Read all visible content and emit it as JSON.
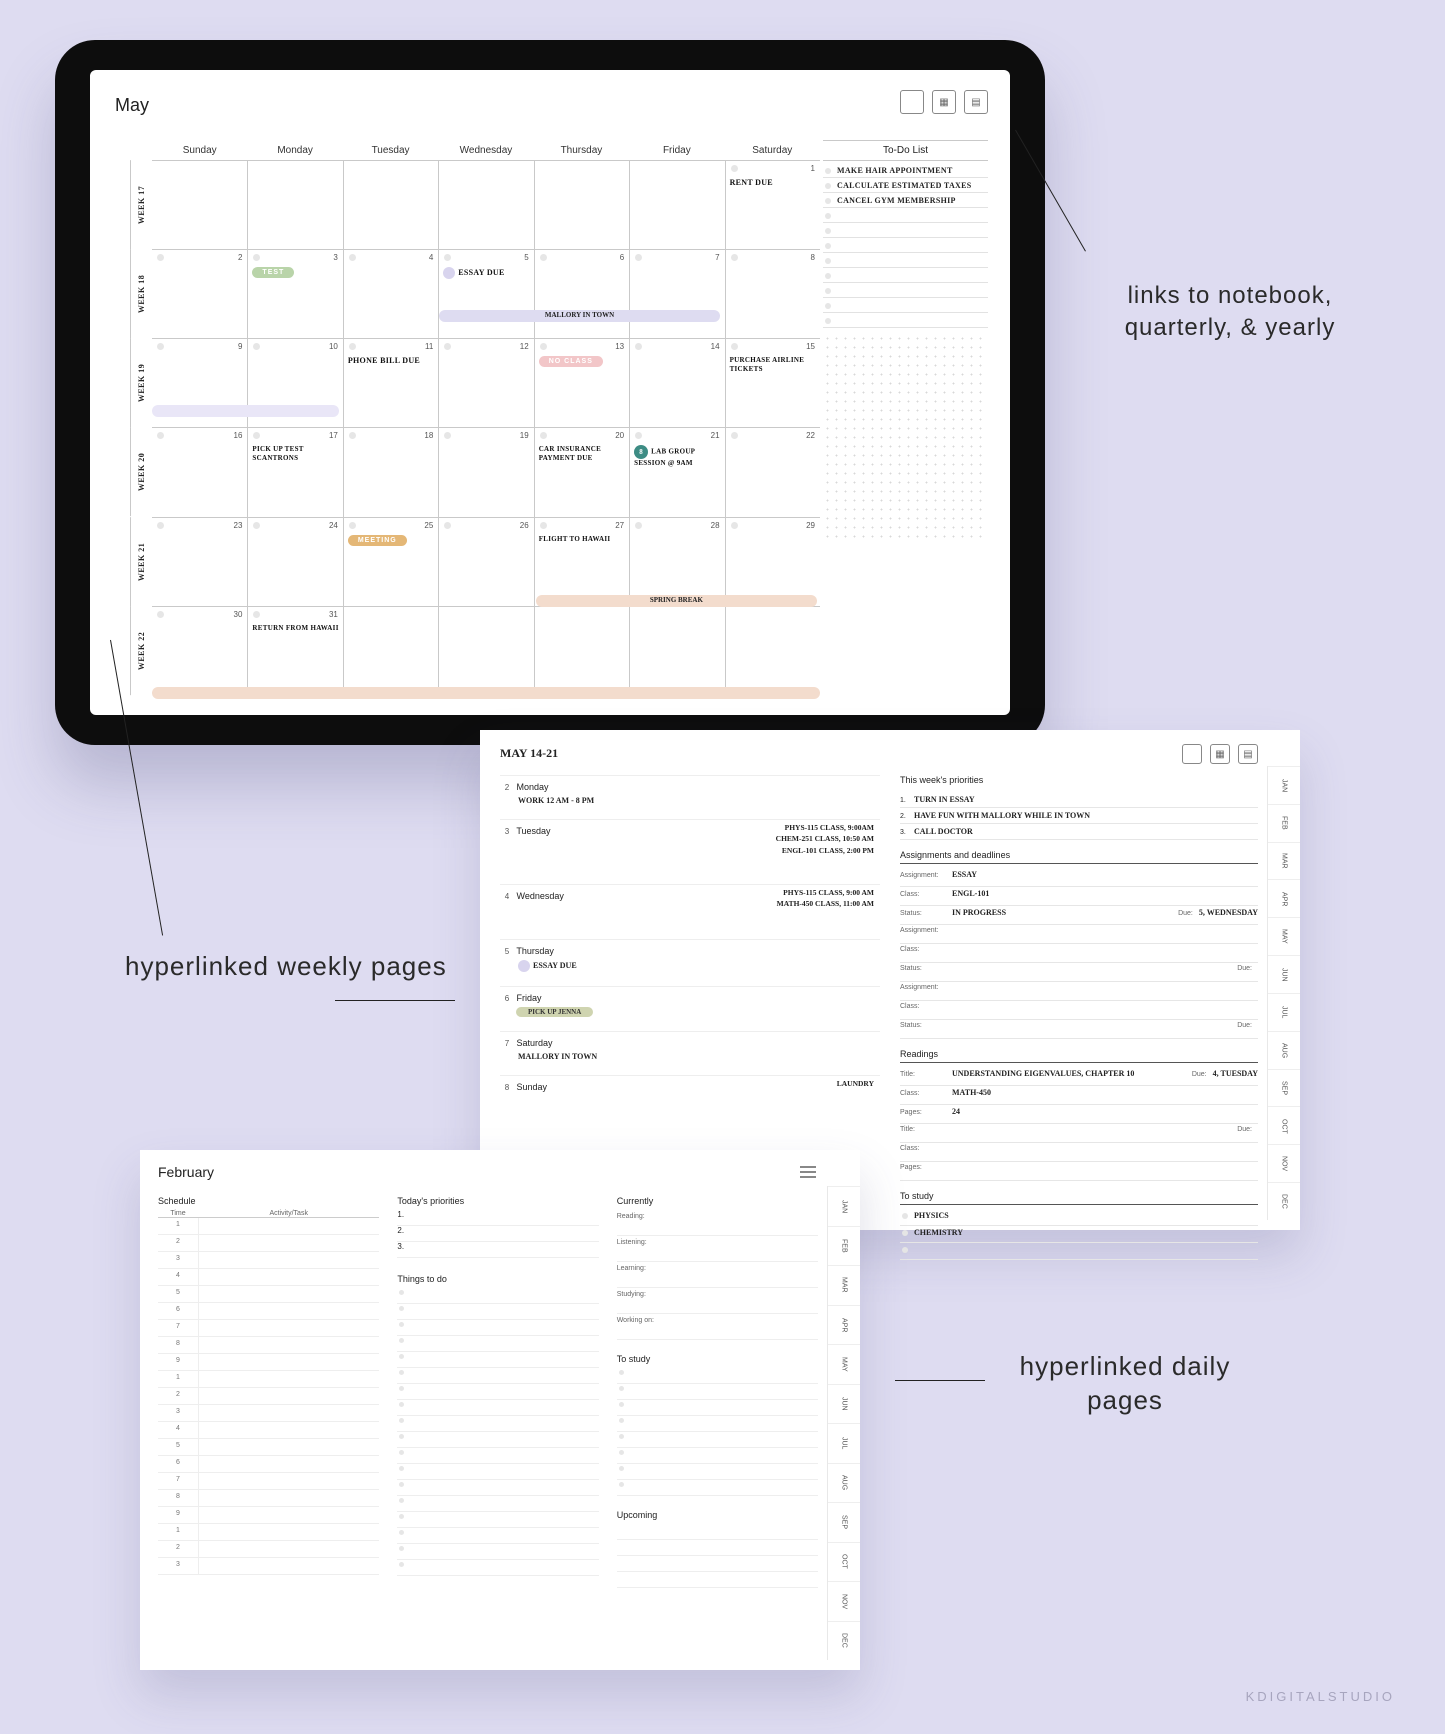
{
  "annotations": {
    "top_right": "links to notebook, quarterly, & yearly",
    "left": "hyperlinked weekly pages",
    "right": "hyperlinked daily pages"
  },
  "watermark": "KDIGITALSTUDIO",
  "monthly": {
    "title": "May",
    "days_of_week": [
      "Sunday",
      "Monday",
      "Tuesday",
      "Wednesday",
      "Thursday",
      "Friday",
      "Saturday"
    ],
    "week_labels": [
      "WEEK 17",
      "WEEK 18",
      "WEEK 19",
      "WEEK 20",
      "WEEK 21",
      "WEEK 22"
    ],
    "todo_title": "To-Do List",
    "todo": [
      "MAKE HAIR APPOINTMENT",
      "CALCULATE ESTIMATED TAXES",
      "CANCEL GYM MEMBERSHIP"
    ],
    "cells": {
      "sat1": "RENT DUE",
      "mon_test": "TEST",
      "wed_essay": "ESSAY DUE",
      "mallory": "MALLORY IN TOWN",
      "tue_phone": "PHONE BILL DUE",
      "thu_noclass": "NO CLASS",
      "sat_airline": "PURCHASE AIRLINE TICKETS",
      "mon_scantrons": "PICK UP TEST SCANTRONS",
      "thu_insurance": "CAR INSURANCE PAYMENT DUE",
      "fri_lab": "LAB GROUP SESSION @ 9AM",
      "tue_meeting": "MEETING",
      "thu_flight": "FLIGHT TO HAWAII",
      "spring_break": "SPRING BREAK",
      "mon_return": "RETURN FROM HAWAII"
    },
    "numbers": [
      "",
      "",
      "",
      "",
      "",
      "",
      "1",
      "2",
      "3",
      "4",
      "5",
      "6",
      "7",
      "8",
      "9",
      "10",
      "11",
      "12",
      "13",
      "14",
      "15",
      "16",
      "17",
      "18",
      "19",
      "20",
      "21",
      "22",
      "23",
      "24",
      "25",
      "26",
      "27",
      "28",
      "29",
      "30",
      "31",
      "",
      "",
      "",
      "",
      ""
    ]
  },
  "weekly": {
    "title": "MAY 14-21",
    "days": [
      {
        "n": "2",
        "name": "Monday",
        "note": "WORK 12 AM - 8 PM"
      },
      {
        "n": "3",
        "name": "Tuesday",
        "right": [
          "PHYS-115 CLASS, 9:00AM",
          "CHEM-251 CLASS, 10:50 AM",
          "ENGL-101 CLASS, 2:00 PM"
        ]
      },
      {
        "n": "4",
        "name": "Wednesday",
        "right": [
          "PHYS-115 CLASS, 9:00 AM",
          "MATH-450 CLASS, 11:00 AM"
        ]
      },
      {
        "n": "5",
        "name": "Thursday",
        "note": "ESSAY DUE",
        "icon": "dot"
      },
      {
        "n": "6",
        "name": "Friday",
        "pill": "PICK UP JENNA"
      },
      {
        "n": "7",
        "name": "Saturday",
        "note": "MALLORY IN TOWN"
      },
      {
        "n": "8",
        "name": "Sunday",
        "rightsingle": "LAUNDRY"
      }
    ],
    "priorities_title": "This week's priorities",
    "priorities": [
      "TURN IN ESSAY",
      "HAVE FUN WITH MALLORY WHILE IN TOWN",
      "CALL DOCTOR"
    ],
    "assign_title": "Assignments and deadlines",
    "assign": {
      "assignment": "ESSAY",
      "class": "ENGL-101",
      "status": "IN PROGRESS",
      "due": "5, WEDNESDAY"
    },
    "readings_title": "Readings",
    "reading": {
      "title": "UNDERSTANDING EIGENVALUES, CHAPTER 10",
      "class": "MATH-450",
      "pages": "24",
      "due": "4, TUESDAY"
    },
    "study_title": "To study",
    "study": [
      "PHYSICS",
      "CHEMISTRY"
    ],
    "labels": {
      "assignment": "Assignment:",
      "class": "Class:",
      "status": "Status:",
      "due": "Due:",
      "title": "Title:",
      "pages": "Pages:"
    }
  },
  "daily": {
    "month": "February",
    "schedule_title": "Schedule",
    "time_label": "Time",
    "task_label": "Activity/Task",
    "hours": [
      "1",
      "2",
      "3",
      "4",
      "5",
      "6",
      "7",
      "8",
      "9",
      "1",
      "2",
      "3",
      "4",
      "5",
      "6",
      "7",
      "8",
      "9",
      "1",
      "2",
      "3"
    ],
    "priorities_title": "Today's priorities",
    "priority_nums": [
      "1.",
      "2.",
      "3."
    ],
    "things_title": "Things to do",
    "currently_title": "Currently",
    "currently": [
      "Reading:",
      "Listening:",
      "Learning:",
      "Studying:",
      "Working on:"
    ],
    "study_title": "To study",
    "upcoming_title": "Upcoming"
  },
  "month_tabs": [
    "JAN",
    "FEB",
    "MAR",
    "APR",
    "MAY",
    "JUN",
    "JUL",
    "AUG",
    "SEP",
    "OCT",
    "NOV",
    "DEC"
  ]
}
